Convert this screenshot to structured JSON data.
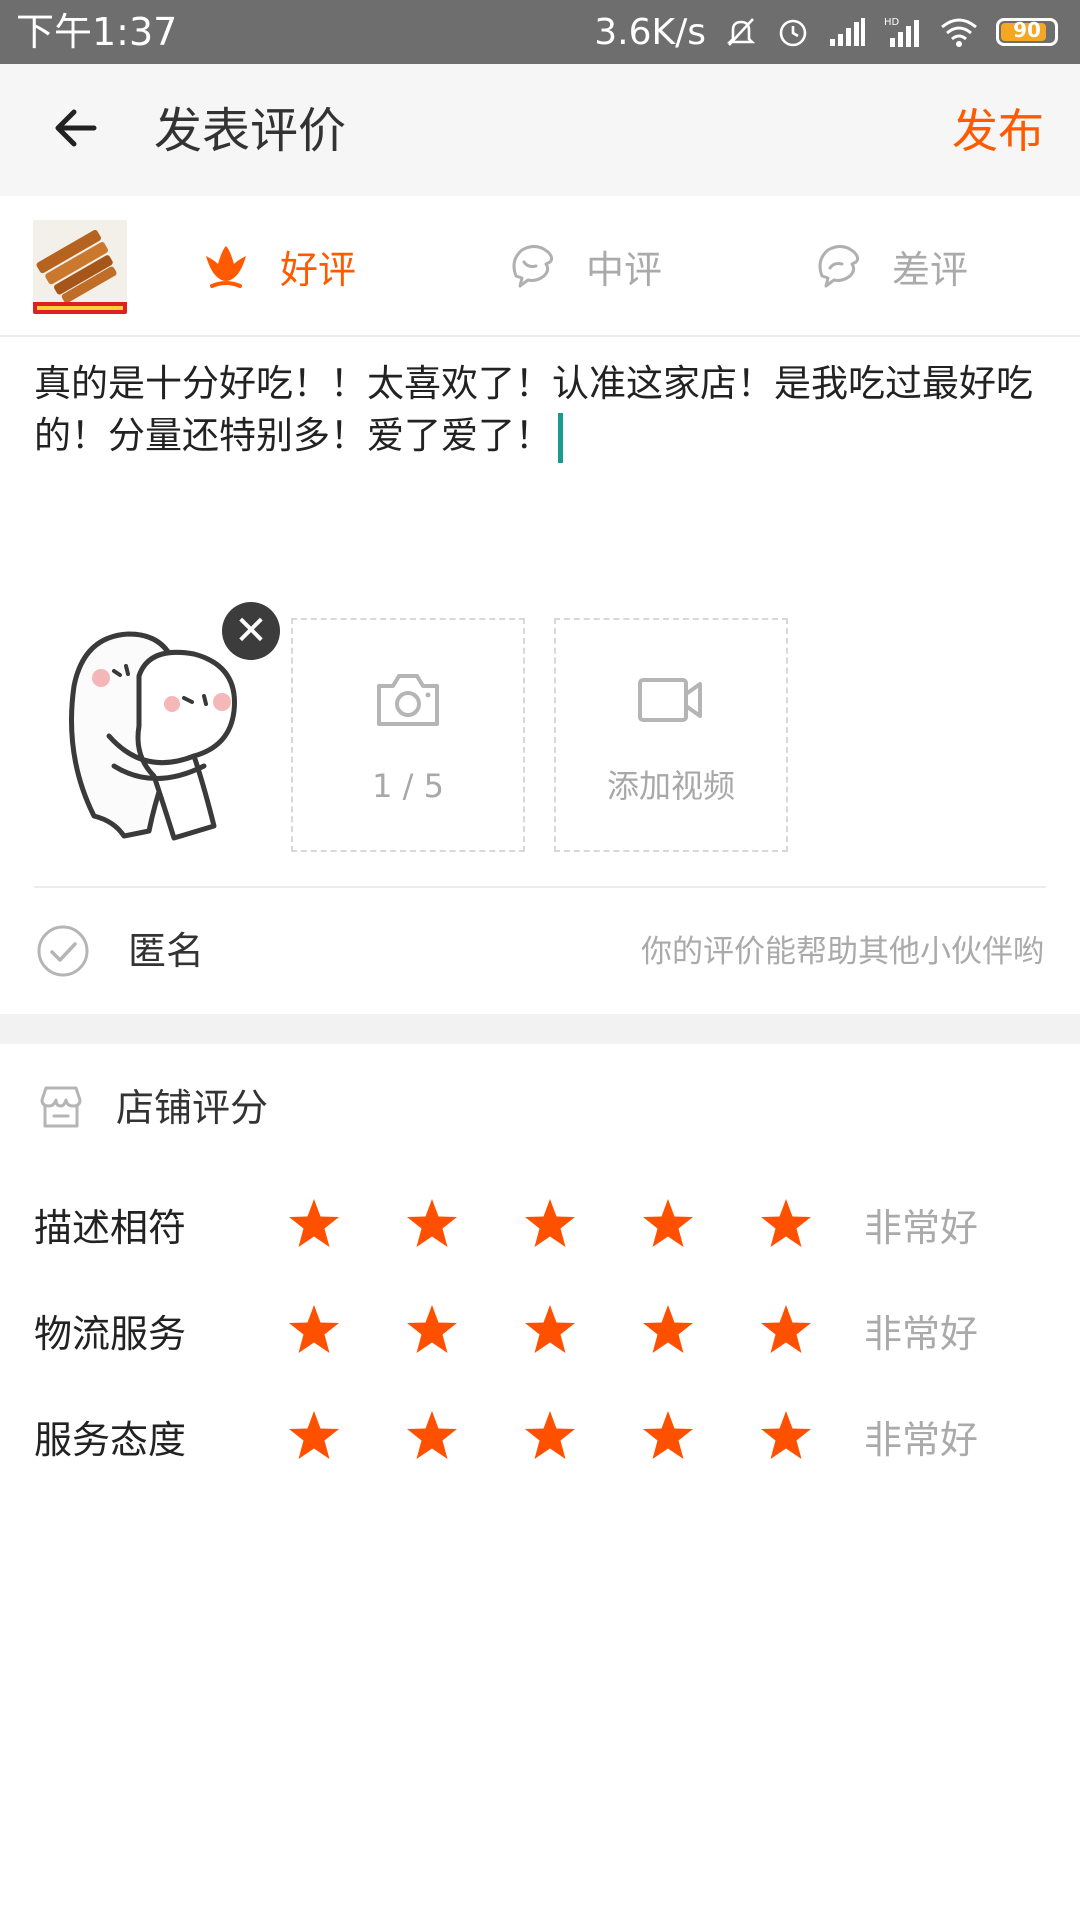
{
  "status_bar": {
    "time": "下午1:37",
    "speed": "3.6K/s",
    "battery": "90",
    "icons": [
      "mute-icon",
      "alarm-icon",
      "signal-icon",
      "hd-signal-icon",
      "wifi-icon",
      "battery-icon"
    ]
  },
  "header": {
    "back_icon": "arrow-left-icon",
    "title": "发表评价",
    "publish_label": "发布",
    "accent_color": "#ff5a00"
  },
  "rating_tabs": [
    {
      "label": "好评",
      "icon": "flower-icon",
      "selected": true
    },
    {
      "label": "中评",
      "icon": "face-icon",
      "selected": false
    },
    {
      "label": "差评",
      "icon": "face-icon",
      "selected": false
    }
  ],
  "review": {
    "text": "真的是十分好吃！！太喜欢了！认准这家店！是我吃过最好吃的！分量还特别多！爱了爱了！"
  },
  "media": {
    "photo_count": "1 / 5",
    "add_video_label": "添加视频"
  },
  "anonymous": {
    "label": "匿名",
    "hint": "你的评价能帮助其他小伙伴哟"
  },
  "store_rating": {
    "title": "店铺评分",
    "rows": [
      {
        "label": "描述相符",
        "stars": 5,
        "text": "非常好"
      },
      {
        "label": "物流服务",
        "stars": 5,
        "text": "非常好"
      },
      {
        "label": "服务态度",
        "stars": 5,
        "text": "非常好"
      }
    ],
    "star_color": "#ff5000"
  }
}
